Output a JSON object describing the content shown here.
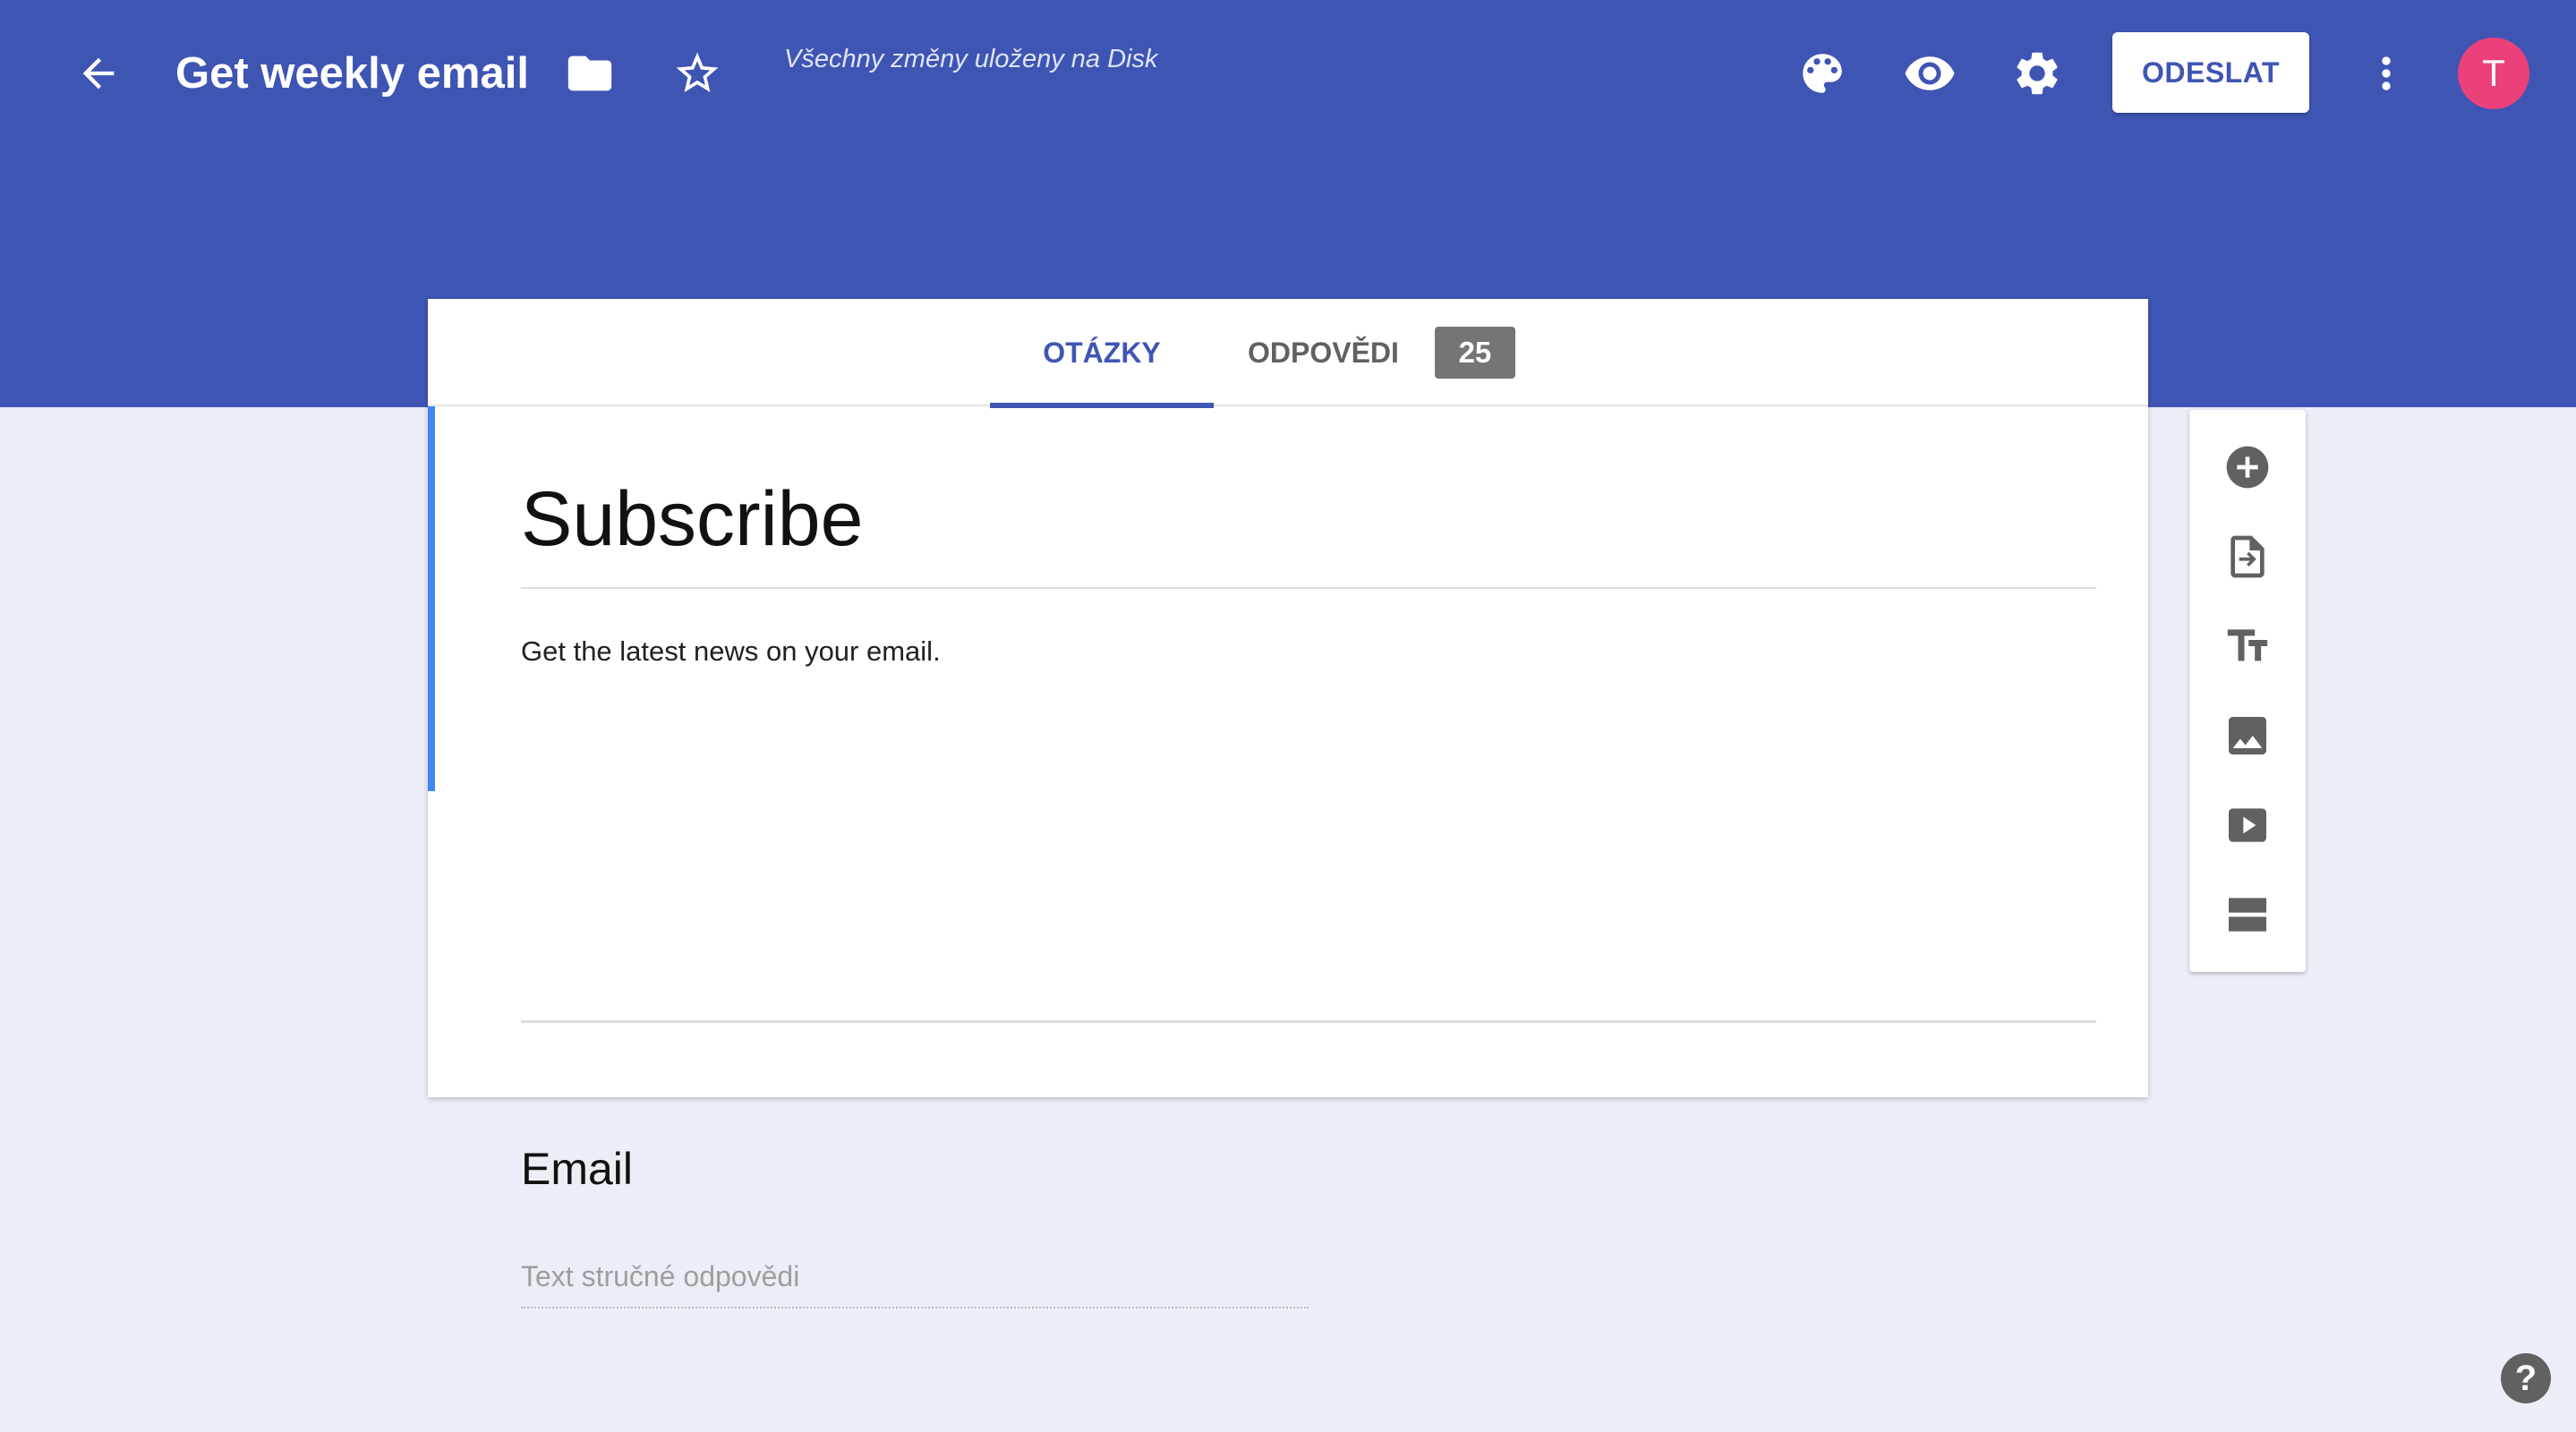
{
  "header": {
    "form_title": "Get weekly email",
    "save_status": "Všechny změny uloženy na Disk",
    "send_label": "ODESLAT",
    "avatar_initial": "T",
    "icons": [
      "arrow-back-icon",
      "folder-icon",
      "star-outline-icon",
      "palette-icon",
      "eye-icon",
      "gear-icon",
      "more-vert-icon"
    ]
  },
  "tabs": {
    "questions_label": "OTÁZKY",
    "responses_label": "ODPOVĚDI",
    "responses_count": "25"
  },
  "form": {
    "title": "Subscribe",
    "description": "Get the latest news on your email.",
    "question_title": "Email",
    "short_answer_placeholder": "Text stručné odpovědi"
  },
  "toolbar": {
    "icons": [
      "add-circle-icon",
      "import-question-icon",
      "title-text-icon",
      "image-icon",
      "video-icon",
      "section-icon"
    ]
  },
  "help_label": "?",
  "colors": {
    "header": "#3f55b3",
    "background": "#eceef7",
    "accent": "#4285f4",
    "avatar": "#ec407a",
    "badge": "#757575"
  }
}
